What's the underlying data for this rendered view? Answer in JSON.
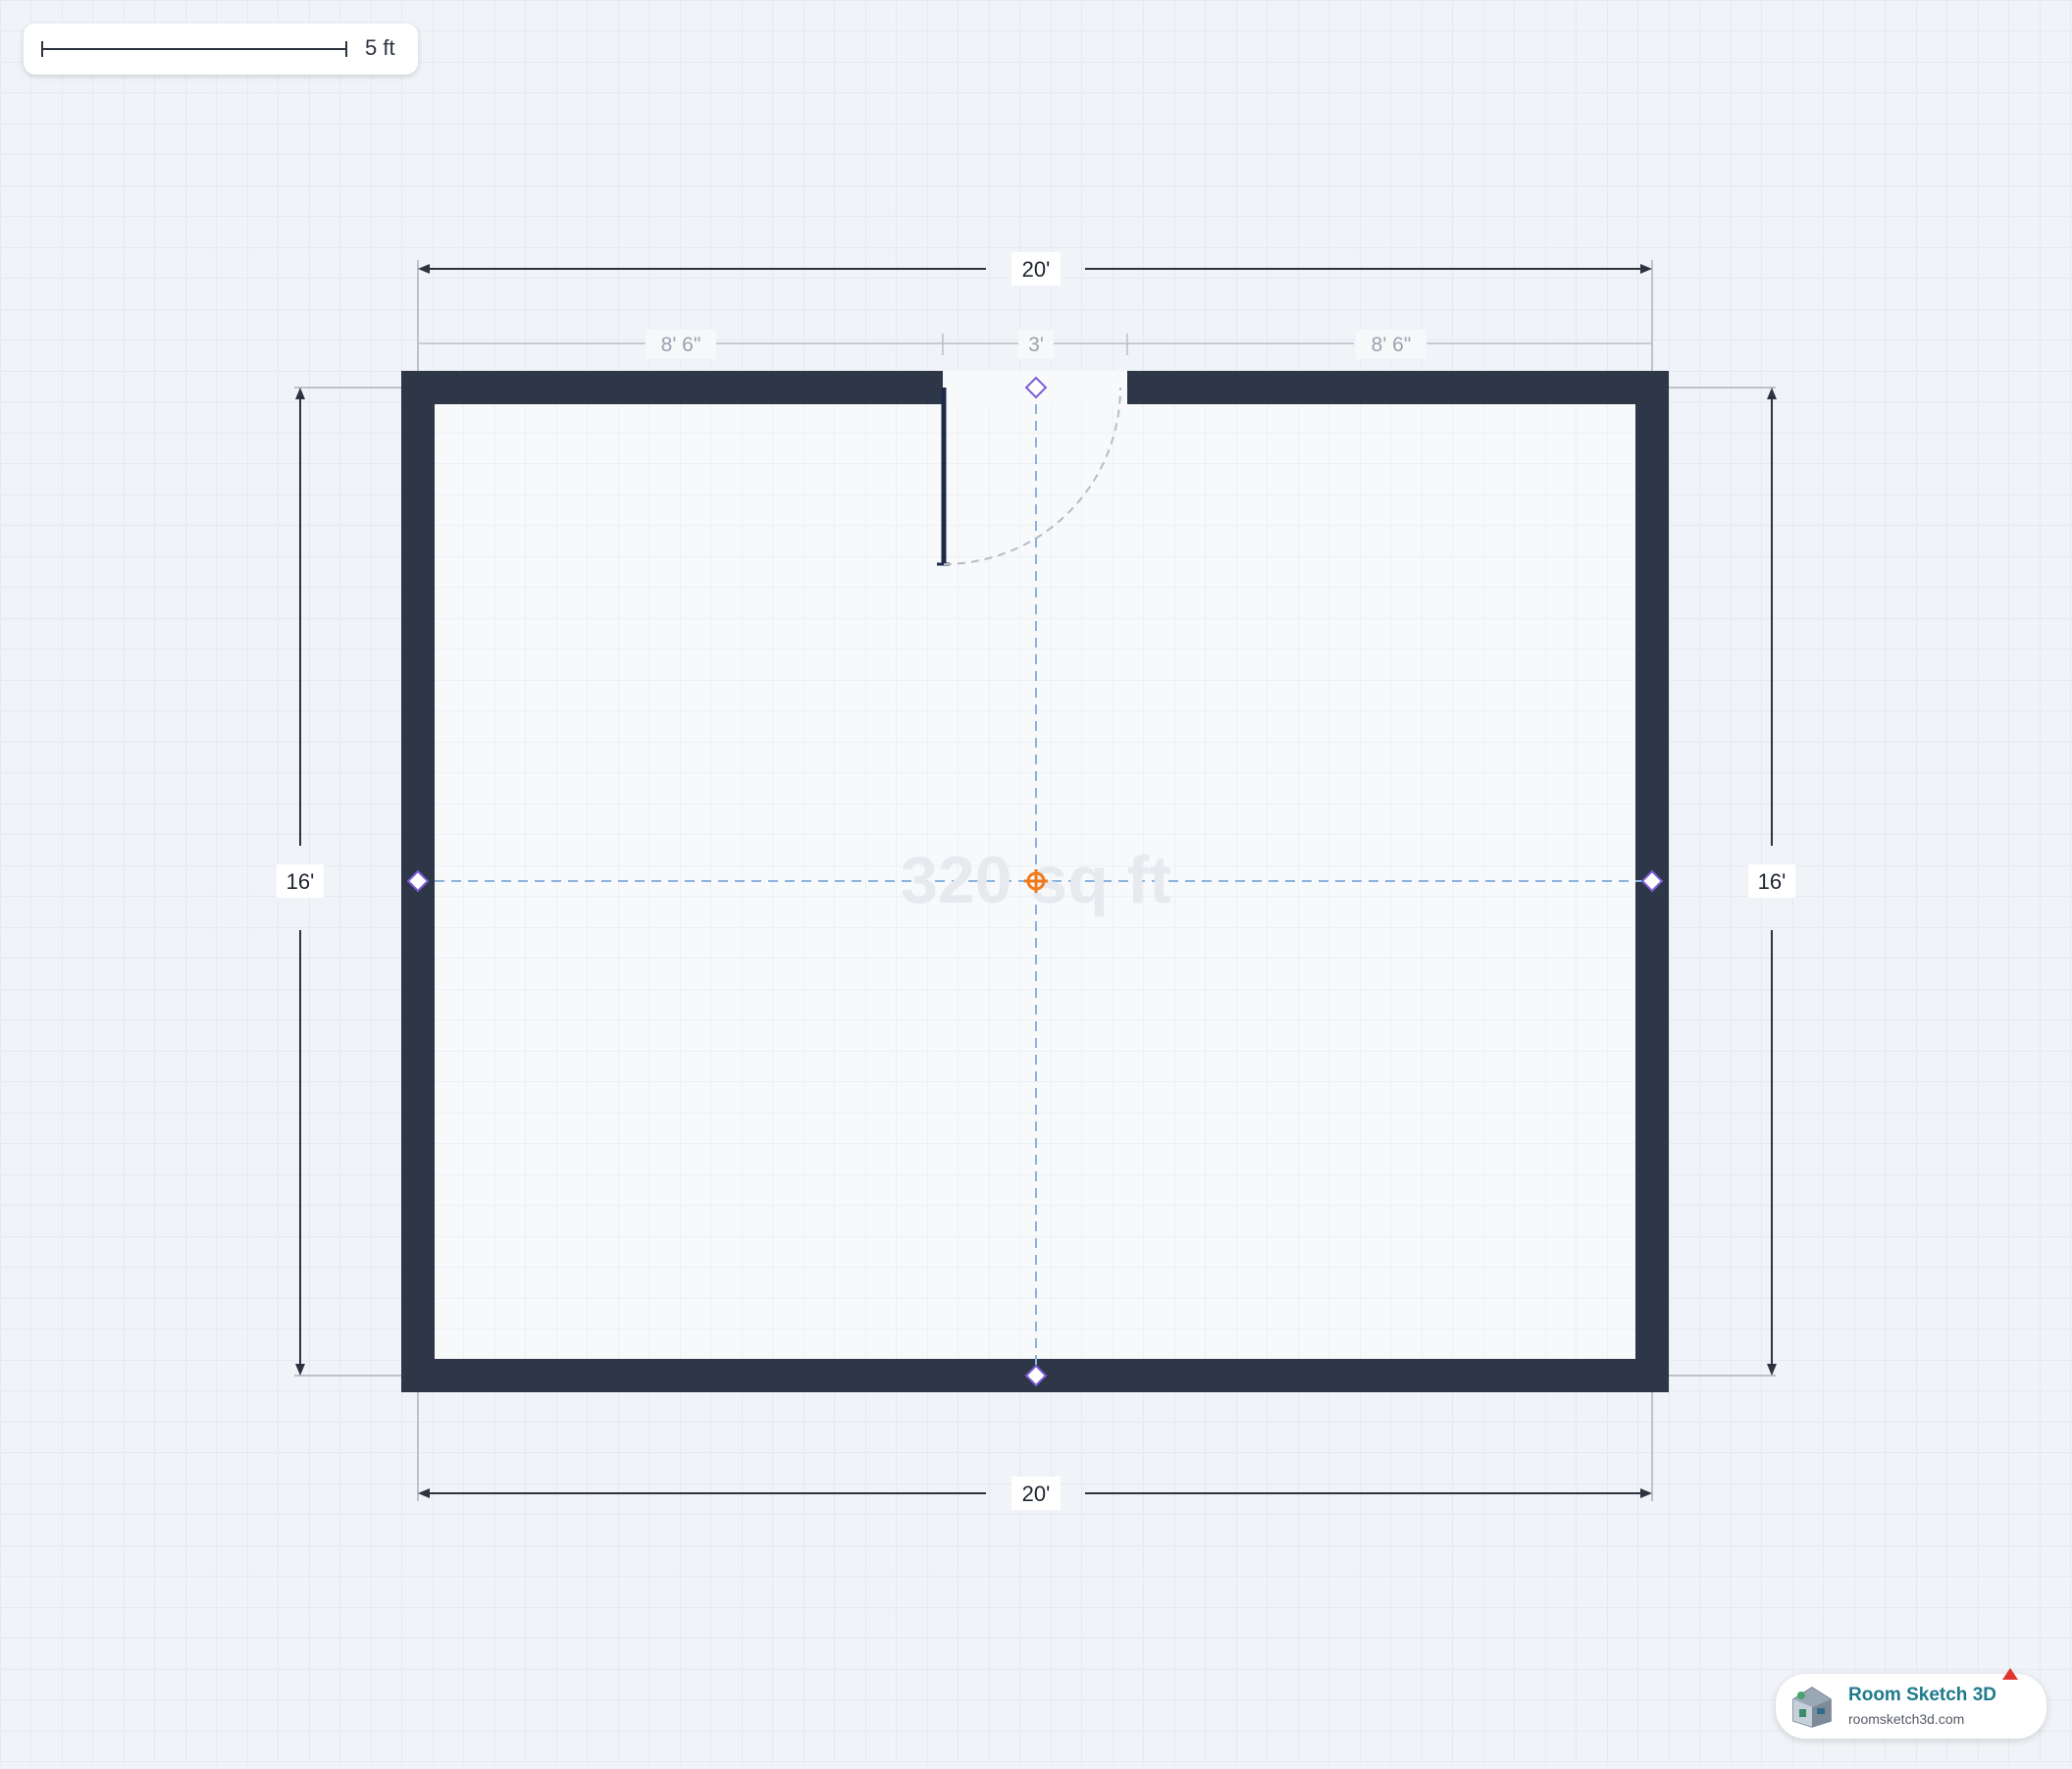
{
  "scale": {
    "label": "5 ft"
  },
  "room": {
    "area_label": "320 sq ft",
    "width_top": "20'",
    "width_bottom": "20'",
    "height_left": "16'",
    "height_right": "16'",
    "segment_left": "8' 6\"",
    "segment_door": "3'",
    "segment_right": "8' 6\""
  },
  "brand": {
    "title": "Room Sketch 3D",
    "url": "roomsketch3d.com"
  },
  "colors": {
    "wall": "#2d3748",
    "room_fill": "#f8f9fb",
    "handle": "#7c5cd6",
    "center": "#f07a1a",
    "guide": "#8ab4e0",
    "brand": "#1f7a8c"
  },
  "icons": {
    "logo": "house-3d-icon",
    "badge": "red-arrow-badge-icon"
  }
}
